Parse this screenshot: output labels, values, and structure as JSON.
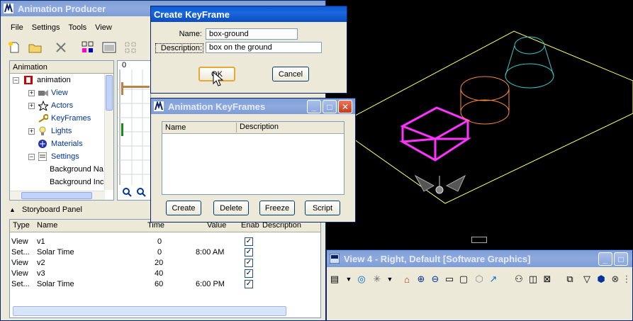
{
  "viewport": {
    "line_colors": {
      "plane": "#ffff66",
      "box": "#ff33ff",
      "cylinder": "#ff8c33",
      "cone": "#33cccc"
    }
  },
  "anim_producer": {
    "title": "Animation Producer",
    "menu": [
      "File",
      "Settings",
      "Tools",
      "View"
    ],
    "tree": {
      "header": "Animation",
      "items": [
        {
          "label": "animation",
          "icon": "film-icon"
        },
        {
          "label": "View",
          "icon": "camera-icon"
        },
        {
          "label": "Actors",
          "icon": "actor-icon"
        },
        {
          "label": "KeyFrames",
          "icon": "key-icon"
        },
        {
          "label": "Lights",
          "icon": "light-bulb-icon"
        },
        {
          "label": "Materials",
          "icon": "material-icon"
        },
        {
          "label": "Settings",
          "icon": "settings-icon"
        },
        {
          "label": "Background Na",
          "icon": ""
        },
        {
          "label": "Background Inc",
          "icon": ""
        }
      ]
    },
    "timeline": {
      "tick_label": "0"
    },
    "storyboard": {
      "title": "Storyboard Panel",
      "columns": [
        "Type",
        "Name",
        "Time",
        "Value",
        "Enab",
        "Description"
      ],
      "rows": [
        {
          "type": "View",
          "name": "v1",
          "time": "0",
          "value": "",
          "enabled": true
        },
        {
          "type": "Set...",
          "name": "Solar Time",
          "time": "0",
          "value": "8:00 AM",
          "enabled": true
        },
        {
          "type": "View",
          "name": "v2",
          "time": "20",
          "value": "",
          "enabled": true
        },
        {
          "type": "View",
          "name": "v3",
          "time": "40",
          "value": "",
          "enabled": true
        },
        {
          "type": "Set...",
          "name": "Solar Time",
          "time": "60",
          "value": "6:00 PM",
          "enabled": true
        }
      ]
    }
  },
  "create_keyframe": {
    "title": "Create KeyFrame",
    "name_label": "Name:",
    "name_value": "box-ground",
    "description_label": "Description:",
    "description_value": "box on the ground",
    "ok_label": "OK",
    "cancel_label": "Cancel"
  },
  "animation_keyframes": {
    "title": "Animation KeyFrames",
    "columns": [
      "Name",
      "Description"
    ],
    "buttons": [
      "Create",
      "Delete",
      "Freeze",
      "Script"
    ]
  },
  "view4": {
    "title": "View 4 - Right, Default [Software Graphics]"
  }
}
